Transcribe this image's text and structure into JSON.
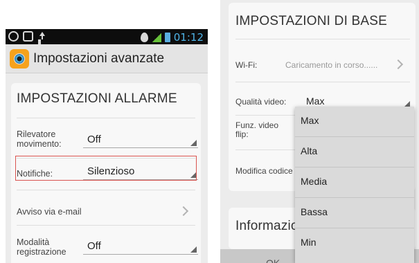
{
  "left": {
    "status_bar": {
      "icons_left": [
        "whatsapp-icon",
        "image-icon",
        "upload-icon"
      ],
      "icons_right": [
        "location-icon",
        "signal-3g-icon",
        "battery-icon"
      ],
      "network": "3G",
      "time": "01:12"
    },
    "action_bar": {
      "title": "Impostazioni avanzate"
    },
    "card": {
      "title": "IMPOSTAZIONI ALLARME",
      "rows": [
        {
          "label": "Rilevatore movimento:",
          "value": "Off"
        },
        {
          "label": "Notifiche:",
          "value": "Silenzioso"
        },
        {
          "label": "Avviso via e-mail"
        },
        {
          "label": "Modalità registrazione",
          "value": "Off"
        }
      ]
    }
  },
  "right": {
    "card": {
      "title": "IMPOSTAZIONI DI BASE",
      "wifi": {
        "label": "Wi-Fi:",
        "value": "Caricamento in corso......"
      },
      "video_quality": {
        "label": "Qualità video:",
        "value": "Max"
      },
      "flip": {
        "label": "Funz. video flip:"
      },
      "edit_code": {
        "label": "Modifica codice"
      }
    },
    "info_card": {
      "title": "Informazio"
    },
    "ok_button": "OK",
    "dropdown": {
      "options": [
        "Max",
        "Alta",
        "Media",
        "Bassa",
        "Min"
      ]
    }
  },
  "colors": {
    "highlight": "#d9534f",
    "clock": "#4fb3e6"
  }
}
